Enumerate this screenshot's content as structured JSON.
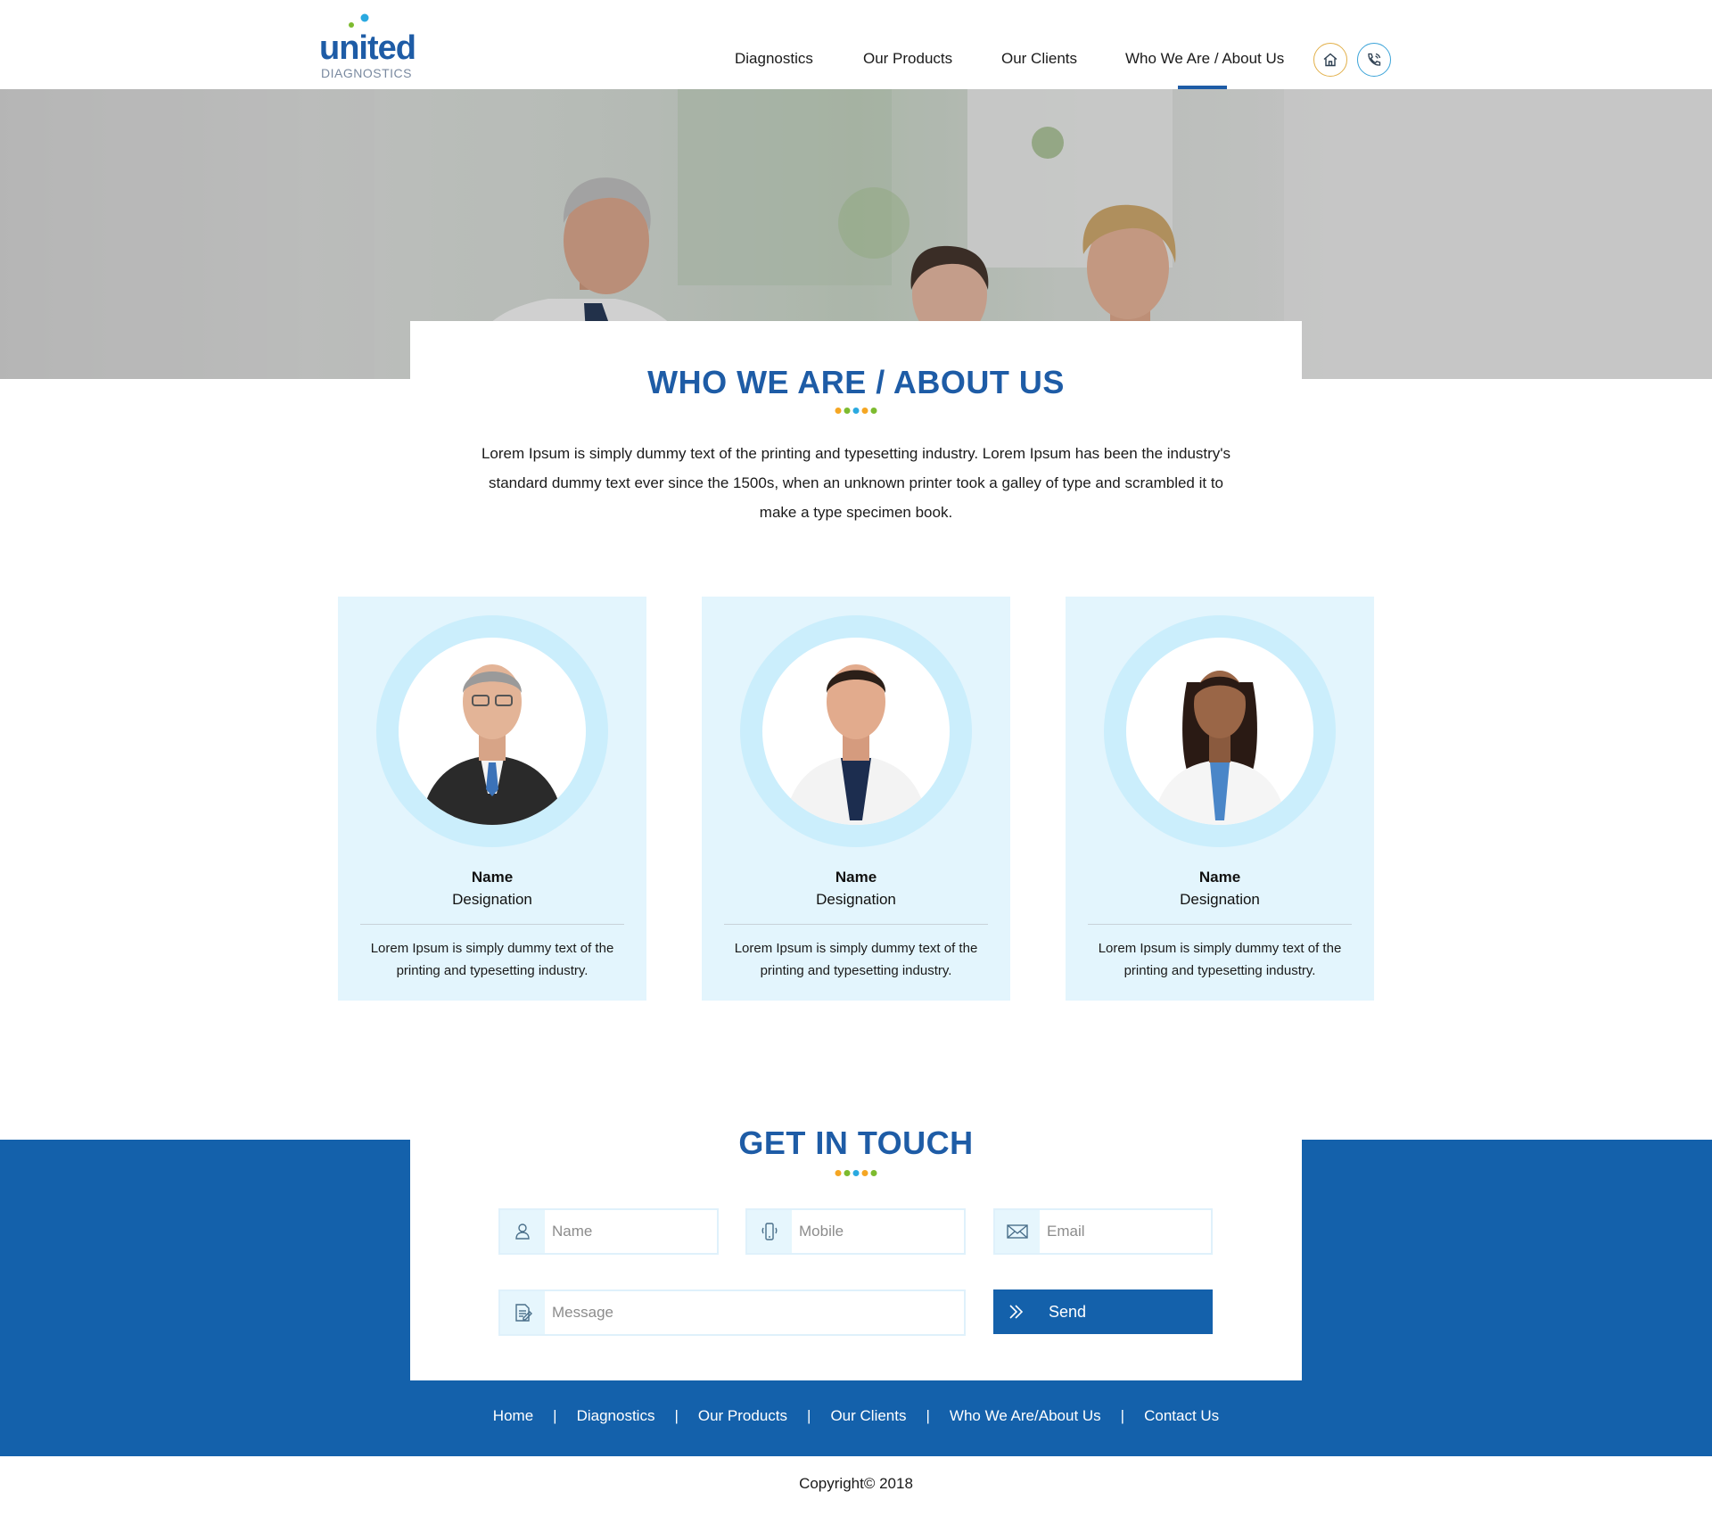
{
  "brand": {
    "logo_main": "united",
    "logo_sub": "DIAGNOSTICS",
    "primary_color": "#1461ab",
    "dot_colors": [
      "#f5a623",
      "#2aa9e0",
      "#7dbb2f",
      "#f5a623",
      "#2aa9e0",
      "#7dbb2f"
    ]
  },
  "nav": {
    "items": [
      {
        "label": "Diagnostics"
      },
      {
        "label": "Our Products"
      },
      {
        "label": "Our Clients"
      },
      {
        "label": "Who We Are / About Us",
        "active": true
      }
    ],
    "home_icon": "home-icon",
    "phone_icon": "phone-icon"
  },
  "about": {
    "title": "WHO WE ARE / ABOUT US",
    "text": "Lorem Ipsum is simply dummy text of the printing and typesetting industry. Lorem Ipsum has been the industry's standard dummy text ever since the 1500s, when an unknown printer took a galley of type and scrambled it to make a type specimen book."
  },
  "team": [
    {
      "name": "Name",
      "designation": "Designation",
      "text": "Lorem Ipsum is simply dummy text of the printing and typesetting industry."
    },
    {
      "name": "Name",
      "designation": "Designation",
      "text": "Lorem Ipsum is simply dummy text of the printing and typesetting industry."
    },
    {
      "name": "Name",
      "designation": "Designation",
      "text": "Lorem Ipsum is simply dummy text of the printing and typesetting industry."
    }
  ],
  "contact": {
    "title": "GET IN TOUCH",
    "name_placeholder": "Name",
    "mobile_placeholder": "Mobile",
    "email_placeholder": "Email",
    "message_placeholder": "Message",
    "send_label": "Send"
  },
  "footer": {
    "links": [
      "Home",
      "Diagnostics",
      "Our Products",
      "Our Clients",
      "Who We Are/About Us",
      "Contact Us"
    ],
    "separator": "|",
    "copyright": "Copyright© 2018"
  }
}
